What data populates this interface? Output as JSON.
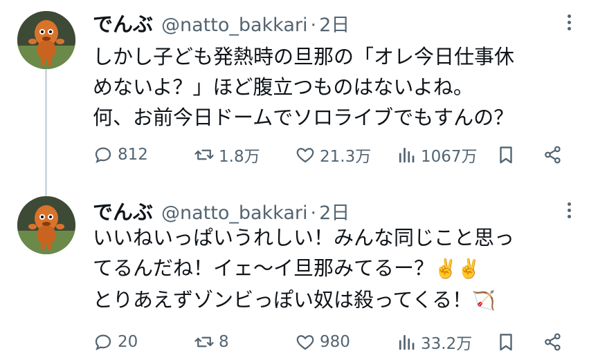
{
  "tweets": [
    {
      "author": "でんぶ",
      "handle": "@natto_bakkari",
      "separator": "·",
      "time": "2日",
      "lines": [
        "しかし子ども発熱時の旦那の「オレ今日仕事休",
        "めないよ？」ほど腹立つものはないよね。",
        "何、お前今日ドームでソロライブでもすんの？"
      ],
      "replies": "812",
      "retweets": "1.8万",
      "likes": "21.3万",
      "views": "1067万",
      "icons": [
        "reply-icon",
        "retweet-icon",
        "like-icon",
        "views-icon",
        "bookmark-icon",
        "share-icon"
      ]
    },
    {
      "author": "でんぶ",
      "handle": "@natto_bakkari",
      "separator": "·",
      "time": "2日",
      "lines": [
        "いいねいっぱいうれしい！みんな同じこと思っ",
        "てるんだね！イェ〜イ旦那みてるー？",
        "とりあえずゾンビっぽい奴は殺ってくる！"
      ],
      "emoji_line2": "✌️✌️",
      "emoji_line3": "🏹",
      "replies": "20",
      "retweets": "8",
      "likes": "980",
      "views": "33.2万",
      "icons": [
        "reply-icon",
        "retweet-icon",
        "like-icon",
        "views-icon",
        "bookmark-icon",
        "share-icon"
      ]
    }
  ],
  "colors": {
    "text": "#0f1419",
    "muted": "#536471",
    "thread_line": "#cfd9de"
  }
}
